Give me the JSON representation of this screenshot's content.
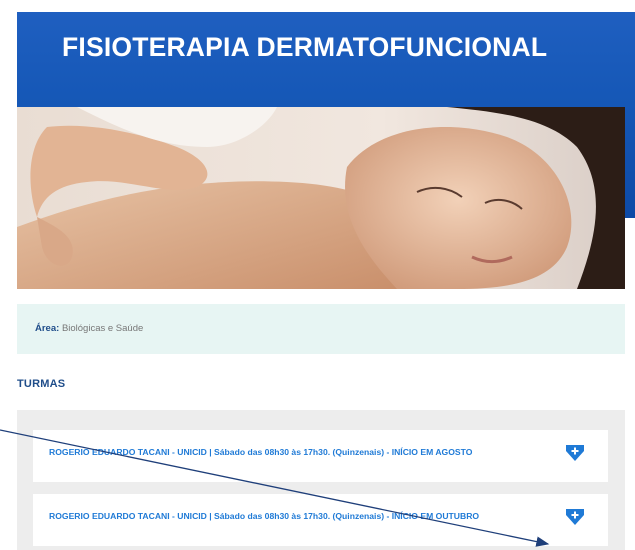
{
  "banner": {
    "title": "FISIOTERAPIA DERMATOFUNCIONAL"
  },
  "area": {
    "label": "Área:",
    "value": "Biológicas e Saúde"
  },
  "section": {
    "title": "TURMAS"
  },
  "turmas": [
    {
      "text": "ROGERIO EDUARDO TACANI - UNICID | Sábado das 08h30 às 17h30. (Quinzenais) - INÍCIO EM AGOSTO",
      "icon": "plus-shield-icon"
    },
    {
      "text": "ROGERIO EDUARDO TACANI - UNICID | Sábado das 08h30 às 17h30. (Quinzenais) - INÍCIO EM OUTUBRO",
      "icon": "plus-shield-icon"
    }
  ],
  "colors": {
    "banner_blue": "#1557b6",
    "link_blue": "#1f7ad6",
    "heading_blue": "#1f4d8a",
    "area_bg": "#e7f5f3",
    "panel_bg": "#ededed"
  }
}
